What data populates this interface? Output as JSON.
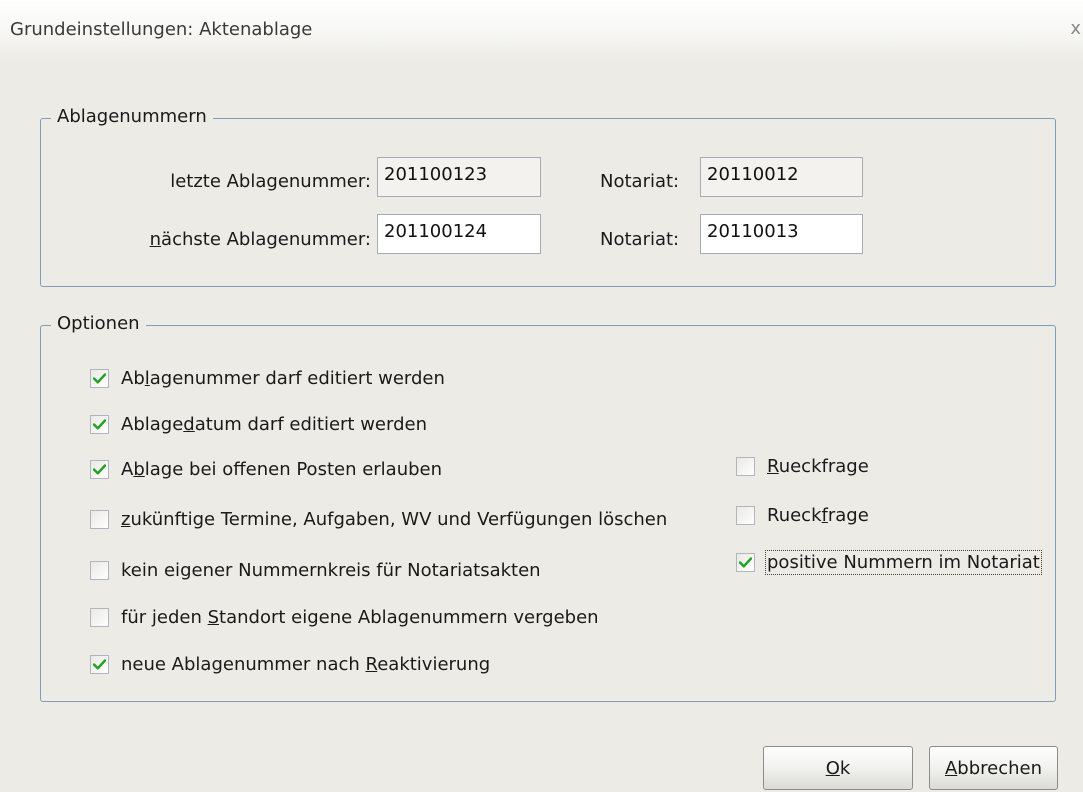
{
  "window": {
    "title": "Grundeinstellungen: Aktenablage",
    "close_glyph": "x"
  },
  "ablagenummern": {
    "legend": "Ablagenummern",
    "letzte_label": "letzte Ablagenummer:",
    "letzte_value": "201100123",
    "letzte_notariat_label": "Notariat:",
    "letzte_notariat_value": "20110012",
    "naechste_label_pre": "",
    "naechste_label_ul": "n",
    "naechste_label_post": "ächste Ablagenummer:",
    "naechste_value": "201100124",
    "naechste_notariat_label": "Notariat:",
    "naechste_notariat_value": "20110013"
  },
  "optionen": {
    "legend": "Optionen",
    "items": [
      {
        "pre": "Ab",
        "ul": "l",
        "post": "agenummer darf editiert werden",
        "checked": true
      },
      {
        "pre": "Ablage",
        "ul": "d",
        "post": "atum darf editiert werden",
        "checked": true
      },
      {
        "pre": "A",
        "ul": "b",
        "post": "lage bei offenen Posten erlauben",
        "checked": true
      },
      {
        "pre": "",
        "ul": "z",
        "post": "ukünftige Termine, Aufgaben, WV und Verfügungen löschen",
        "checked": false
      },
      {
        "pre": "kein eigener Nummernkreis für Notariatsakten",
        "ul": "",
        "post": "",
        "checked": false
      },
      {
        "pre": "für jeden ",
        "ul": "S",
        "post": "tandort eigene Ablagenummern vergeben",
        "checked": false
      },
      {
        "pre": "neue Ablagenummer nach ",
        "ul": "R",
        "post": "eaktivierung",
        "checked": true
      }
    ],
    "right_items": [
      {
        "pre": "",
        "ul": "R",
        "post": "ueckfrage",
        "checked": false
      },
      {
        "pre": "Rueck",
        "ul": "f",
        "post": "rage",
        "checked": false
      },
      {
        "pre": "positive Nummern im Notariat",
        "ul": "",
        "post": "",
        "checked": true
      }
    ]
  },
  "buttons": {
    "ok_ul": "O",
    "ok_post": "k",
    "cancel_ul": "A",
    "cancel_post": "bbrechen"
  },
  "colors": {
    "border": "#7f9db9",
    "background": "#ecebe6",
    "check": "#21a121"
  }
}
